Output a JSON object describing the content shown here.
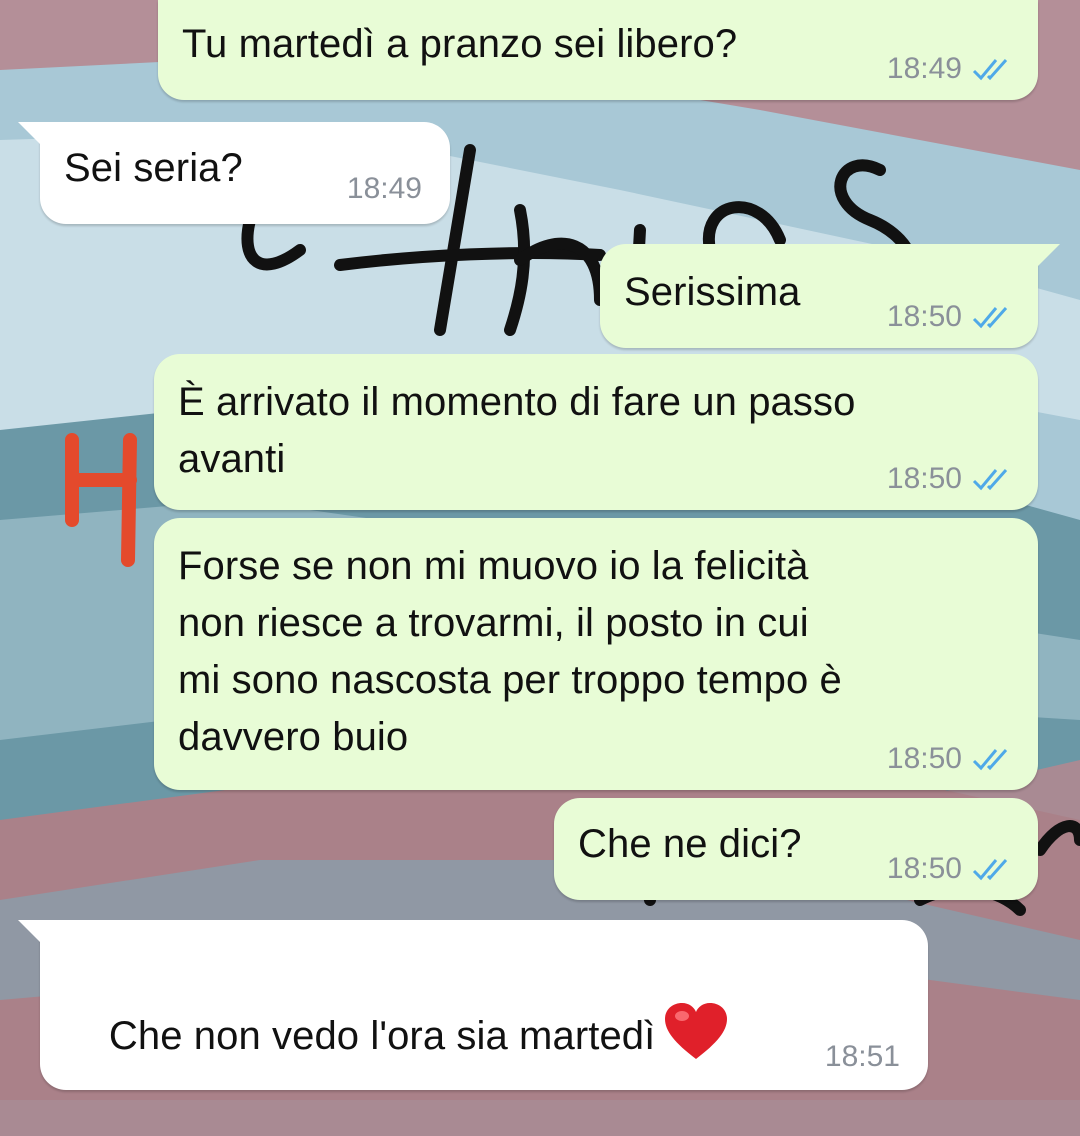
{
  "chat": {
    "messages": [
      {
        "dir": "out",
        "text": "Tu martedì a pranzo sei libero?",
        "time": "18:49",
        "status": "read"
      },
      {
        "dir": "in",
        "text": "Sei seria?",
        "time": "18:49"
      },
      {
        "dir": "out",
        "text": "Serissima",
        "time": "18:50",
        "status": "read"
      },
      {
        "dir": "out",
        "text": "È arrivato il momento di fare un passo\navanti",
        "time": "18:50",
        "status": "read"
      },
      {
        "dir": "out",
        "text": "Forse se non mi muovo io la felicità\nnon riesce a trovarmi, il posto in cui\nmi sono nascosta per troppo tempo è\ndavvero buio",
        "time": "18:50",
        "status": "read"
      },
      {
        "dir": "out",
        "text": "Che ne dici?",
        "time": "18:50",
        "status": "read"
      },
      {
        "dir": "in",
        "text": "Che non vedo l'ora sia martedì",
        "emoji": "heart-icon",
        "time": "18:51"
      }
    ]
  },
  "wallpaper": {
    "scribble_text": "things"
  },
  "colors": {
    "outgoing_bubble": "#e8fcd6",
    "incoming_bubble": "#ffffff",
    "read_ticks": "#4fa9e8",
    "timestamp": "#8a9099",
    "annotation_mark": "#e44a2c"
  }
}
